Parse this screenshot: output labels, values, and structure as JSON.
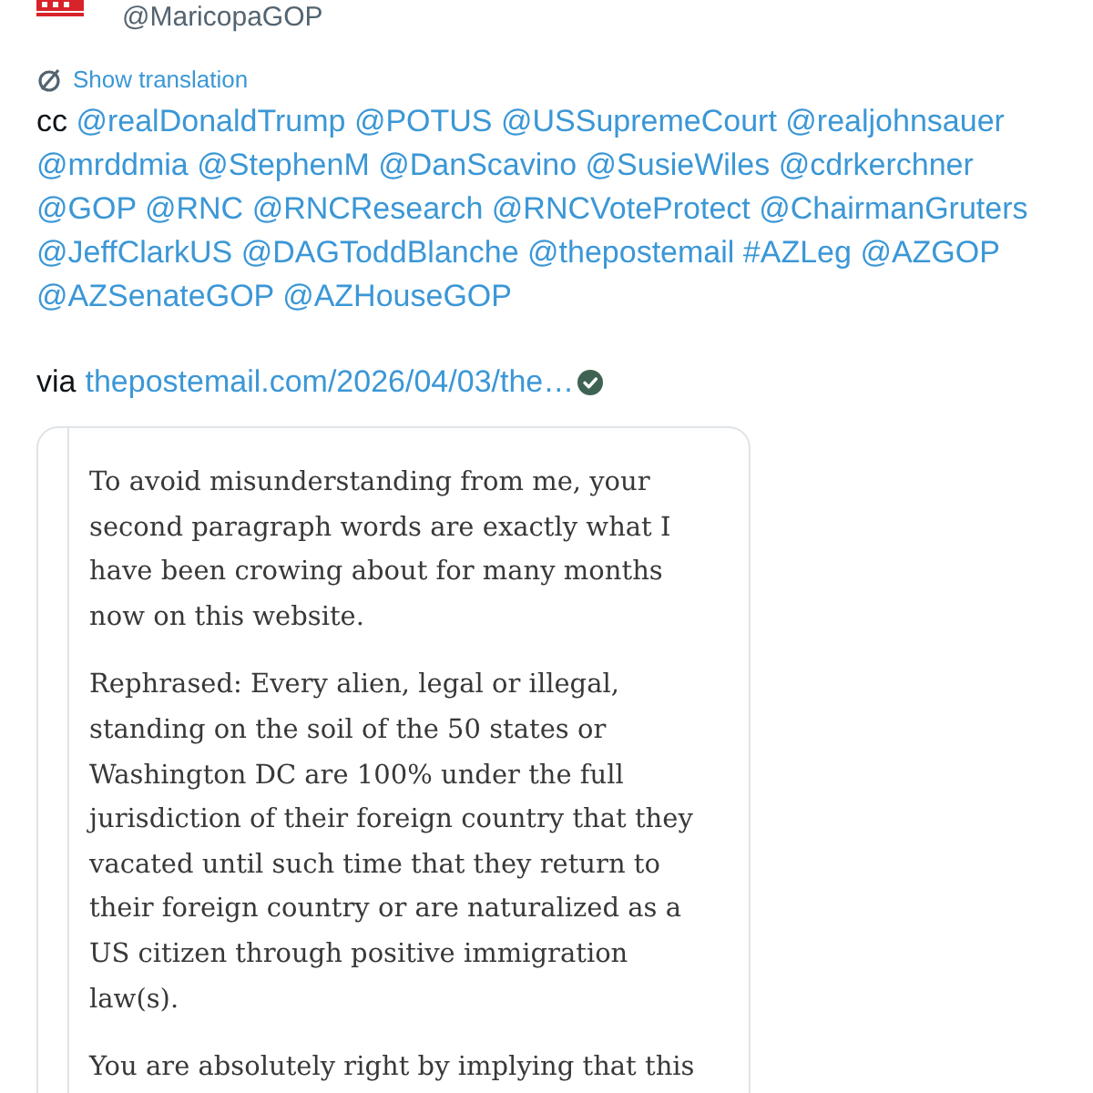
{
  "account": {
    "handle": "@MaricopaGOP"
  },
  "translation": {
    "label": "Show translation"
  },
  "tweet": {
    "parts": [
      {
        "kind": "plain",
        "text": "cc"
      },
      {
        "kind": "link",
        "text": "@realDonaldTrump"
      },
      {
        "kind": "link",
        "text": "@POTUS"
      },
      {
        "kind": "link",
        "text": "@USSupremeCourt"
      },
      {
        "kind": "link",
        "text": "@realjohnsauer"
      },
      {
        "kind": "link",
        "text": "@mrddmia"
      },
      {
        "kind": "link",
        "text": "@StephenM"
      },
      {
        "kind": "link",
        "text": "@DanScavino"
      },
      {
        "kind": "link",
        "text": "@SusieWiles"
      },
      {
        "kind": "link",
        "text": "@cdrkerchner"
      },
      {
        "kind": "link",
        "text": "@GOP"
      },
      {
        "kind": "link",
        "text": "@RNC"
      },
      {
        "kind": "link",
        "text": "@RNCResearch"
      },
      {
        "kind": "link",
        "text": "@RNCVoteProtect"
      },
      {
        "kind": "link",
        "text": "@ChairmanGruters"
      },
      {
        "kind": "link",
        "text": "@JeffClarkUS"
      },
      {
        "kind": "link",
        "text": "@DAGToddBlanche"
      },
      {
        "kind": "link",
        "text": "@thepostemail"
      },
      {
        "kind": "link",
        "text": "#AZLeg"
      },
      {
        "kind": "link",
        "text": "@AZGOP"
      },
      {
        "kind": "link",
        "text": "@AZSenateGOP"
      },
      {
        "kind": "link",
        "text": "@AZHouseGOP"
      }
    ]
  },
  "via": {
    "label": "via",
    "link": "thepostemail.com/2026/04/03/the…"
  },
  "quote": {
    "paragraphs": [
      "To avoid misunderstanding from me, your second paragraph words are exactly what I have been crowing about for many months now on this website.",
      "Rephrased: Every alien, legal or illegal, standing on the soil of the 50 states or Washington DC are 100% under the full jurisdiction of their foreign country that they vacated until such time that they return to their foreign country or are naturalized as a US citizen through positive immigration law(s).",
      "You are absolutely right by implying that this"
    ]
  }
}
